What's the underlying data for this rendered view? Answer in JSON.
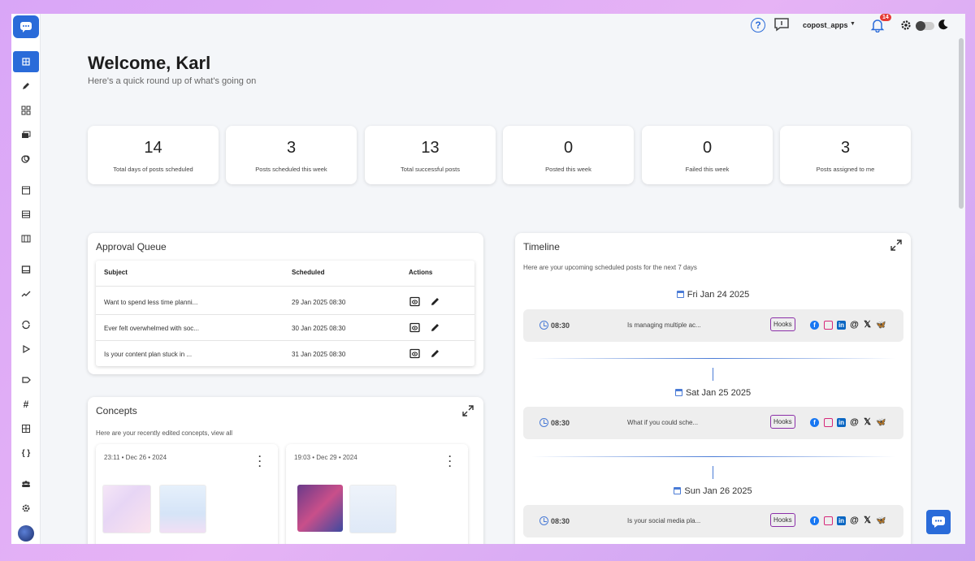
{
  "topbar": {
    "help": "?",
    "account": "copost_apps",
    "notifications": "14"
  },
  "welcome": {
    "title": "Welcome, Karl",
    "subtitle": "Here's a quick round up of what's going on"
  },
  "stats": [
    {
      "value": "14",
      "label": "Total days of posts scheduled"
    },
    {
      "value": "3",
      "label": "Posts scheduled this week"
    },
    {
      "value": "13",
      "label": "Total successful posts"
    },
    {
      "value": "0",
      "label": "Posted this week"
    },
    {
      "value": "0",
      "label": "Failed this week"
    },
    {
      "value": "3",
      "label": "Posts assigned to me"
    }
  ],
  "approval": {
    "title": "Approval Queue",
    "headers": {
      "subject": "Subject",
      "scheduled": "Scheduled",
      "actions": "Actions"
    },
    "rows": [
      {
        "subject": "Want to spend less time planni...",
        "scheduled": "29 Jan 2025 08:30"
      },
      {
        "subject": "Ever felt overwhelmed with soc...",
        "scheduled": "30 Jan 2025 08:30"
      },
      {
        "subject": "Is your content plan stuck in ...",
        "scheduled": "31 Jan 2025 08:30"
      }
    ]
  },
  "concepts": {
    "title": "Concepts",
    "subtitle": "Here are your recently edited concepts, view all",
    "items": [
      {
        "date": "23:11 • Dec 26 • 2024"
      },
      {
        "date": "19:03 • Dec 29 • 2024"
      }
    ]
  },
  "timeline": {
    "title": "Timeline",
    "subtitle": "Here are your upcoming scheduled posts for the next 7 days",
    "days": [
      {
        "date": "Fri Jan 24 2025",
        "time": "08:30",
        "text": "Is managing multiple ac...",
        "tag": "Hooks"
      },
      {
        "date": "Sat Jan 25 2025",
        "time": "08:30",
        "text": "What if you could sche...",
        "tag": "Hooks"
      },
      {
        "date": "Sun Jan 26 2025",
        "time": "08:30",
        "text": "Is your social media pla...",
        "tag": "Hooks"
      }
    ],
    "social_icons": [
      "facebook-icon",
      "instagram-icon",
      "linkedin-icon",
      "threads-icon",
      "x-icon",
      "bluesky-icon"
    ]
  },
  "colors": {
    "accent": "#2a6bd9",
    "tag_border": "#8b2fa8",
    "badge": "#e53935"
  }
}
